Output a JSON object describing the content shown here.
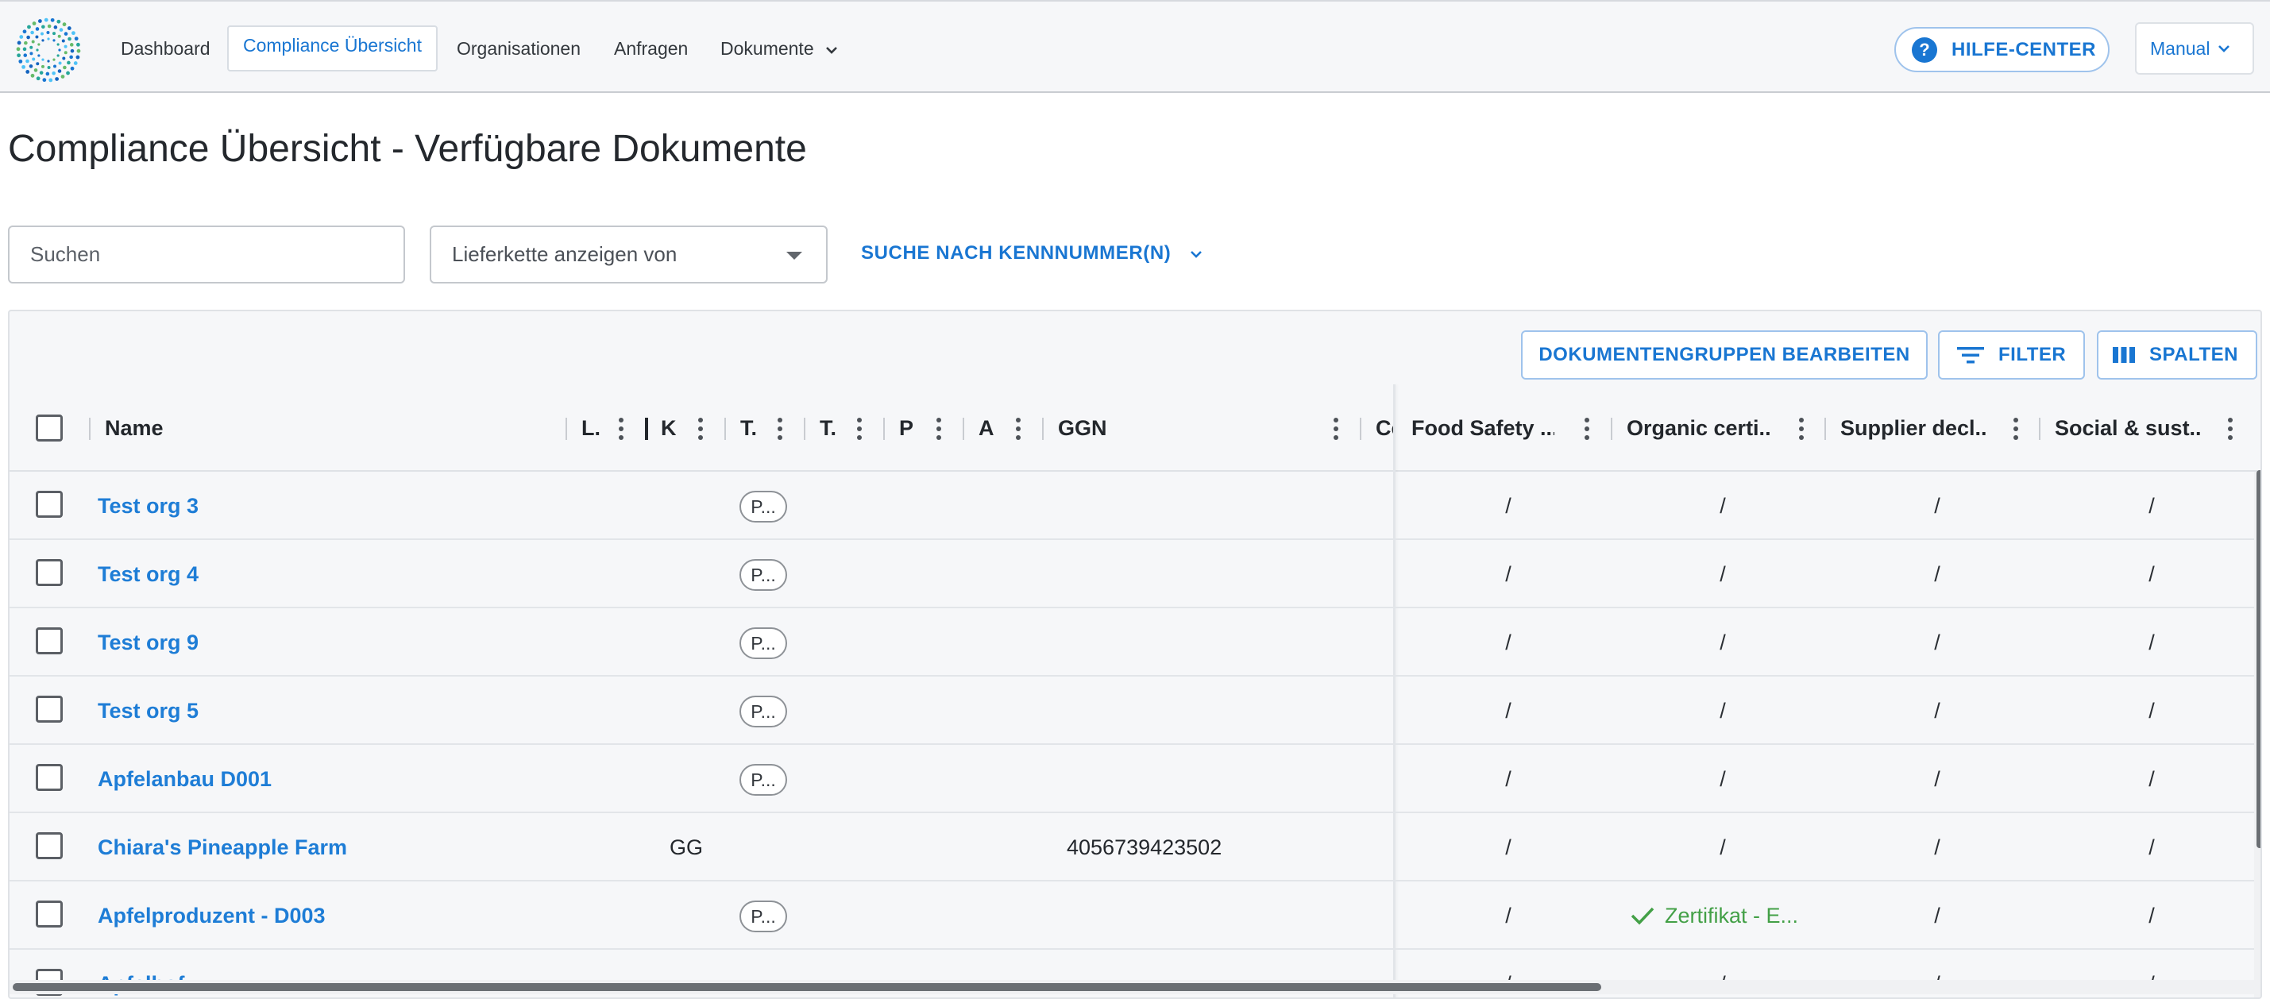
{
  "nav": {
    "items": [
      {
        "label": "Dashboard"
      },
      {
        "label": "Compliance Übersicht"
      },
      {
        "label": "Organisationen"
      },
      {
        "label": "Anfragen"
      },
      {
        "label": "Dokumente"
      }
    ],
    "help_label": "HILFE-CENTER",
    "manual_label": "Manual"
  },
  "page": {
    "title": "Compliance Übersicht - Verfügbare Dokumente",
    "search_placeholder": "Suchen",
    "supply_chain_placeholder": "Lieferkette anzeigen von",
    "id_search_label": "SUCHE NACH KENNNUMMER(N)"
  },
  "toolbar": {
    "groups_label": "DOKUMENTENGRUPPEN BEARBEITEN",
    "filter_label": "FILTER",
    "columns_label": "SPALTEN"
  },
  "columns": {
    "name": "Name",
    "l": "L.",
    "k": "K",
    "t1": "T.",
    "t2": "T.",
    "p": "P",
    "a": "A",
    "ggn": "GGN",
    "co": "Co",
    "food_safety": "Food Safety ...",
    "organic": "Organic certi...",
    "supplier": "Supplier decl...",
    "social": "Social & sust..."
  },
  "rows": [
    {
      "name": "Test org 3",
      "chip": "P...",
      "k": "",
      "ggn": "",
      "food_safety": "/",
      "organic": "/",
      "supplier": "/",
      "social": "/"
    },
    {
      "name": "Test org 4",
      "chip": "P...",
      "k": "",
      "ggn": "",
      "food_safety": "/",
      "organic": "/",
      "supplier": "/",
      "social": "/"
    },
    {
      "name": "Test org 9",
      "chip": "P...",
      "k": "",
      "ggn": "",
      "food_safety": "/",
      "organic": "/",
      "supplier": "/",
      "social": "/"
    },
    {
      "name": "Test org 5",
      "chip": "P...",
      "k": "",
      "ggn": "",
      "food_safety": "/",
      "organic": "/",
      "supplier": "/",
      "social": "/"
    },
    {
      "name": "Apfelanbau D001",
      "chip": "P...",
      "k": "",
      "ggn": "",
      "food_safety": "/",
      "organic": "/",
      "supplier": "/",
      "social": "/"
    },
    {
      "name": "Chiara's Pineapple Farm",
      "chip": "",
      "k": "GG",
      "ggn": "4056739423502",
      "food_safety": "/",
      "organic": "/",
      "supplier": "/",
      "social": "/"
    },
    {
      "name": "Apfelproduzent - D003",
      "chip": "P...",
      "k": "",
      "ggn": "",
      "food_safety": "/",
      "organic": "Zertifikat - E...",
      "organic_status": "certified",
      "supplier": "/",
      "social": "/"
    },
    {
      "name": "Apfelhof",
      "chip": "",
      "k": "",
      "ggn": "",
      "food_safety": "/",
      "organic": "/",
      "supplier": "/",
      "social": "/"
    }
  ],
  "colors": {
    "accent": "#1976d2",
    "link": "#1e7dd6",
    "success": "#43a047"
  }
}
